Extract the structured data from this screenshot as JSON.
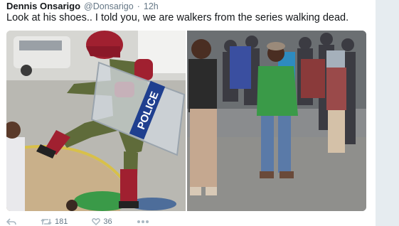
{
  "tweet": {
    "display_name": "Dennis Onsarigo",
    "handle": "@Donsarigo",
    "separator": "·",
    "time": "12h",
    "text": "Look at his shoes.. I told you, we are walkers from the series walking dead."
  },
  "media": {
    "left_photo_sign_text": "POLICE"
  },
  "actions": {
    "retweet_count": "181",
    "like_count": "36"
  },
  "colors": {
    "name": "#14171a",
    "meta": "#657786",
    "rail": "#e6ecf0",
    "police_camo": "#5f6b3a",
    "police_red": "#a02030",
    "green_jacket": "#3a9a48"
  },
  "icons": [
    "reply-icon",
    "retweet-icon",
    "like-icon",
    "more-icon"
  ]
}
